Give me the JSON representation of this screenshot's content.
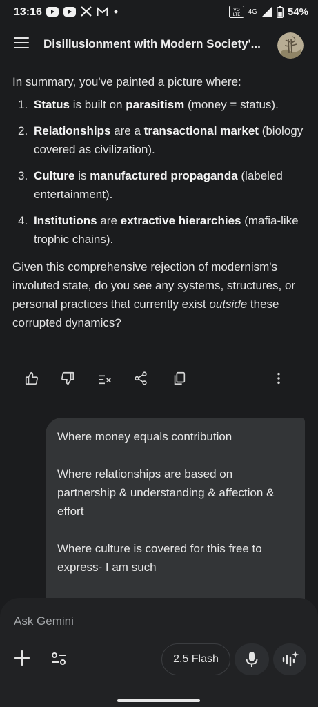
{
  "status_bar": {
    "time": "13:16",
    "network_label": "4G",
    "volte_label": "VO LTE",
    "battery": "54%",
    "icons": [
      "youtube-icon",
      "youtube-icon",
      "x-icon",
      "gmail-icon",
      "dot-icon",
      "volte-icon",
      "signal-icon",
      "battery-icon"
    ]
  },
  "header": {
    "title": "Disillusionment with Modern Society'..."
  },
  "response": {
    "intro": "In summary, you've painted a picture where:",
    "items": [
      {
        "num": "1.",
        "a": "Status",
        "b": " is built on ",
        "c": "parasitism",
        "d": " (money = status)."
      },
      {
        "num": "2.",
        "a": "Relationships",
        "b": " are a ",
        "c": "transactional market",
        "d": " (biology covered as civilization)."
      },
      {
        "num": "3.",
        "a": "Culture",
        "b": " is ",
        "c": "manufactured propaganda",
        "d": " (labeled entertainment)."
      },
      {
        "num": "4.",
        "a": "Institutions",
        "b": " are ",
        "c": "extractive hierarchies",
        "d": " (mafia-like trophic chains)."
      }
    ],
    "closing_before": "Given this comprehensive rejection of modernism's involuted state, do you see any systems, structures, or personal practices that currently exist ",
    "closing_emphasis": "outside",
    "closing_after": " these corrupted dynamics?"
  },
  "actions": {
    "icons": [
      "thumbs-up-icon",
      "thumbs-down-icon",
      "modify-response-icon",
      "share-icon",
      "copy-icon",
      "more-options-icon"
    ]
  },
  "user_message": {
    "paragraphs": [
      "Where money equals contribution",
      "Where relationships are based on partnership & understanding & affection & effort",
      "Where culture is covered for this free to express- I am such"
    ]
  },
  "composer": {
    "placeholder": "Ask Gemini",
    "model": "2.5 Flash"
  },
  "colors": {
    "background": "#1b1c1e",
    "bubble": "#333537",
    "composer": "#212224",
    "text": "#e3e3e3"
  }
}
